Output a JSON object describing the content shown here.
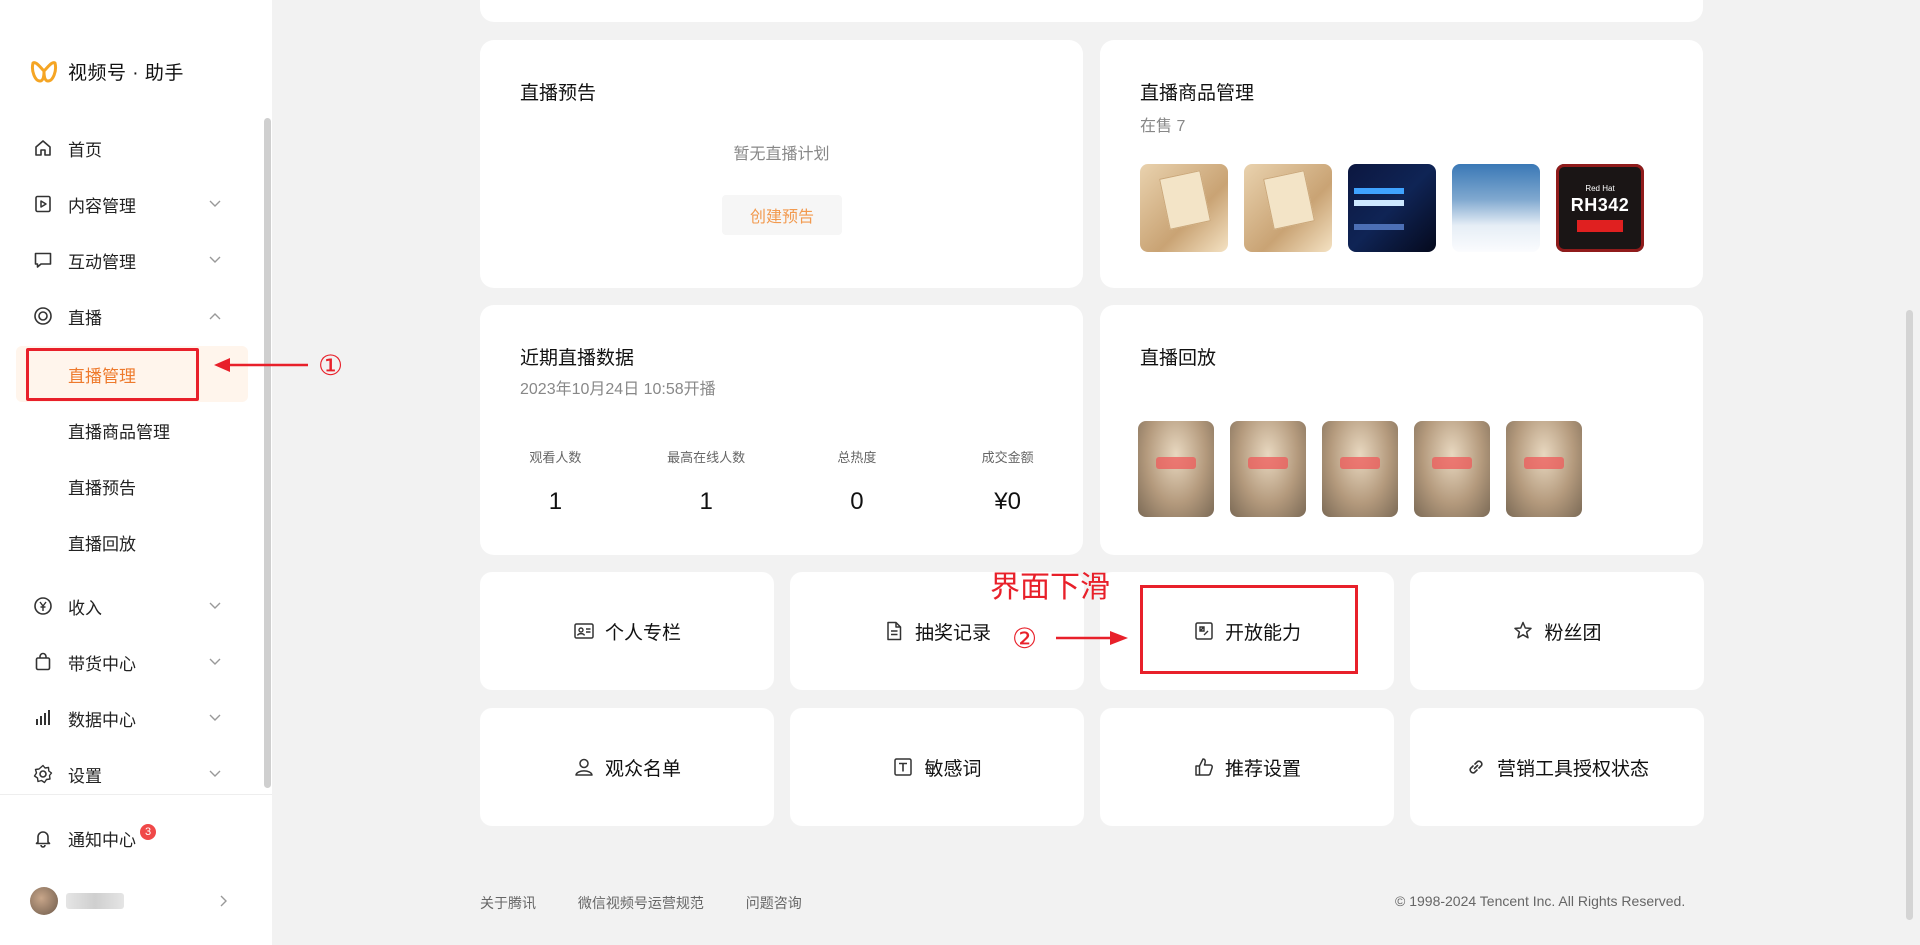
{
  "app": {
    "title": "视频号 · 助手"
  },
  "sidebar": {
    "items": [
      {
        "label": "首页",
        "icon": "home-icon"
      },
      {
        "label": "内容管理",
        "icon": "content-icon"
      },
      {
        "label": "互动管理",
        "icon": "comment-icon"
      },
      {
        "label": "直播",
        "icon": "live-icon"
      }
    ],
    "live_sub": {
      "active": "直播管理",
      "items": [
        "直播商品管理",
        "直播预告",
        "直播回放"
      ]
    },
    "more_items": [
      {
        "label": "收入",
        "icon": "yen-icon"
      },
      {
        "label": "带货中心",
        "icon": "bag-icon"
      },
      {
        "label": "数据中心",
        "icon": "bar-chart-icon"
      },
      {
        "label": "设置",
        "icon": "gear-icon"
      }
    ],
    "notification": {
      "label": "通知中心",
      "count": "3"
    }
  },
  "preview": {
    "title": "直播预告",
    "empty_text": "暂无直播计划",
    "create_label": "创建预告"
  },
  "products": {
    "title": "直播商品管理",
    "subtitle": "在售 7",
    "redhat_brand": "Red Hat",
    "redhat_code": "RH342"
  },
  "recent": {
    "title": "近期直播数据",
    "date": "2023年10月24日 10:58开播",
    "stats": [
      {
        "label": "观看人数",
        "value": "1"
      },
      {
        "label": "最高在线人数",
        "value": "1"
      },
      {
        "label": "总热度",
        "value": "0"
      },
      {
        "label": "成交金额",
        "value": "¥0"
      }
    ]
  },
  "replay": {
    "title": "直播回放"
  },
  "actions": [
    {
      "label": "个人专栏",
      "icon": "id-card-icon"
    },
    {
      "label": "抽奖记录",
      "icon": "document-icon"
    },
    {
      "label": "开放能力",
      "icon": "puzzle-icon"
    },
    {
      "label": "粉丝团",
      "icon": "star-icon"
    },
    {
      "label": "观众名单",
      "icon": "user-icon"
    },
    {
      "label": "敏感词",
      "icon": "text-icon"
    },
    {
      "label": "推荐设置",
      "icon": "thumb-up-icon"
    },
    {
      "label": "营销工具授权状态",
      "icon": "link-icon"
    }
  ],
  "annotations": {
    "step1": "①",
    "step2": "②",
    "scroll_hint": "界面下滑"
  },
  "footer": {
    "links": [
      "关于腾讯",
      "微信视频号运营规范",
      "问题咨询"
    ],
    "copyright": "© 1998-2024 Tencent Inc. All Rights Reserved."
  },
  "colors": {
    "accent": "#ee7a2c",
    "annotation": "#e8202a",
    "badge": "#f04848"
  }
}
